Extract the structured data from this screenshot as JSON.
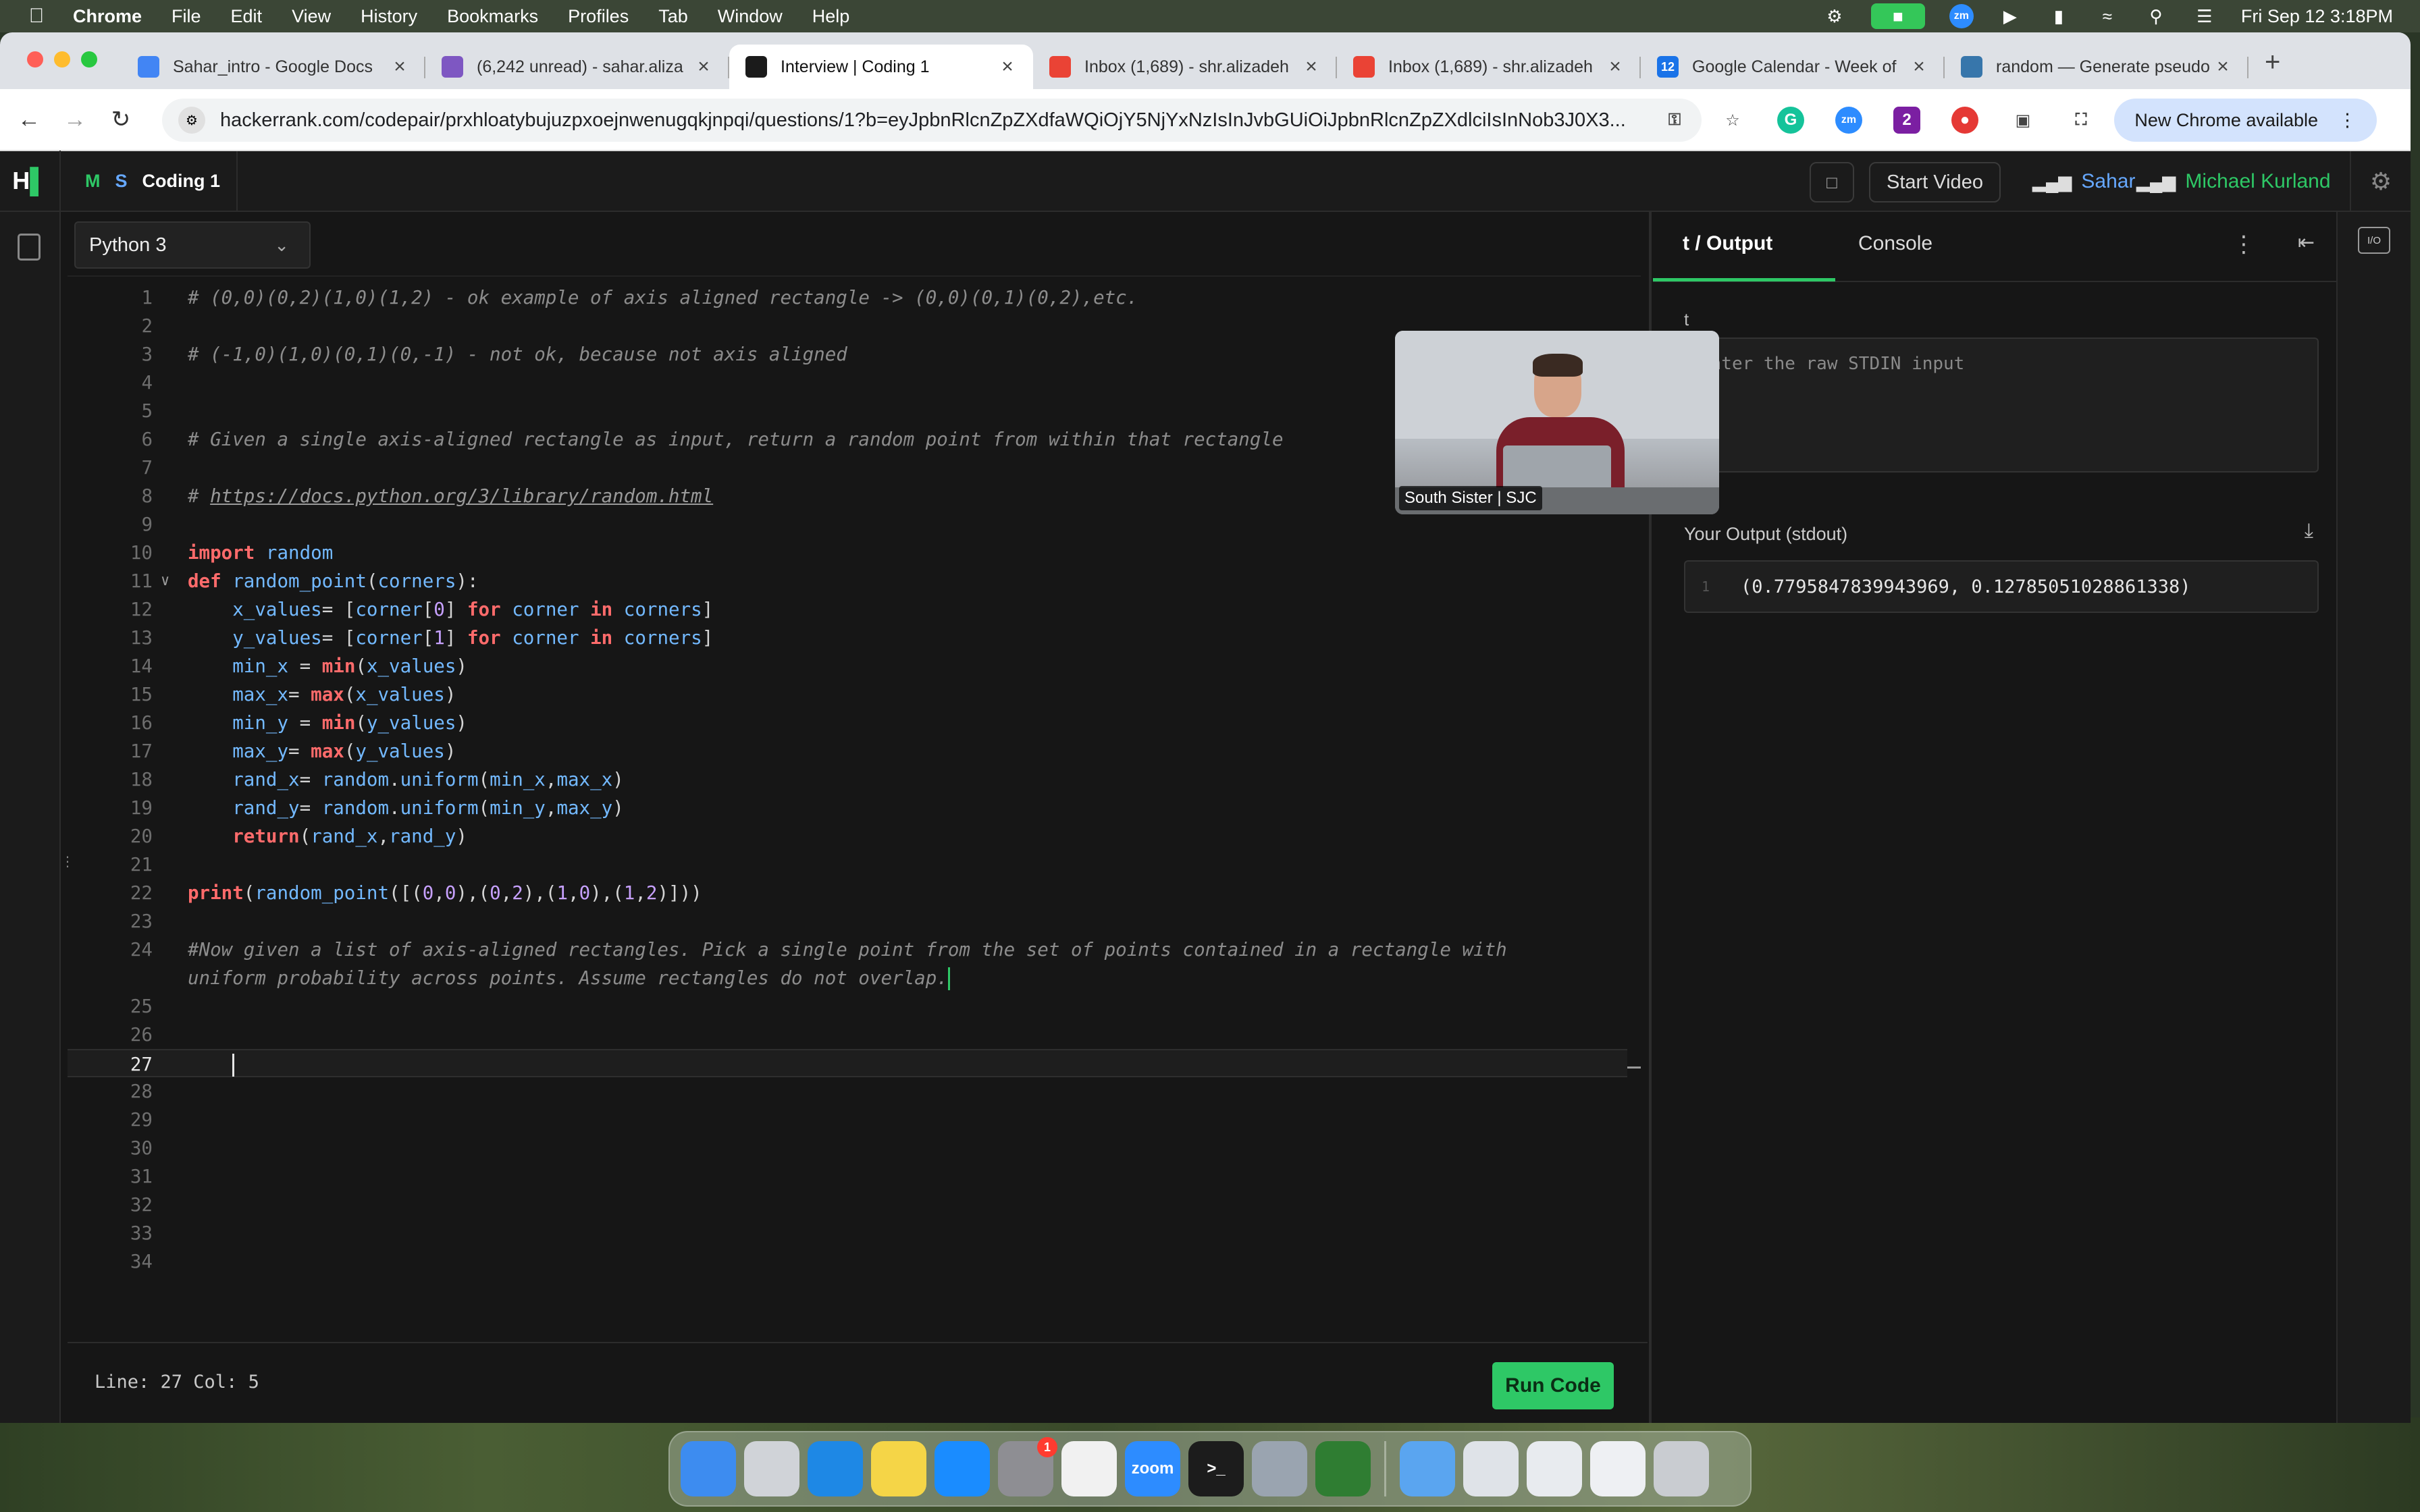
{
  "menubar": {
    "app": "Chrome",
    "items": [
      "File",
      "Edit",
      "View",
      "History",
      "Bookmarks",
      "Profiles",
      "Tab",
      "Window",
      "Help"
    ],
    "clock": "Fri Sep 12  3:18PM",
    "zoom_icon": "zm"
  },
  "tabs": [
    {
      "title": "Sahar_intro - Google Docs",
      "icon": "docs-icon",
      "color": "#4285f4"
    },
    {
      "title": "(6,242 unread) - sahar.aliza",
      "icon": "mail-icon",
      "color": "#7e57c2"
    },
    {
      "title": "Interview | Coding 1",
      "icon": "hackerrank-icon",
      "color": "#1b1b1b",
      "active": true
    },
    {
      "title": "Inbox (1,689) - shr.alizadeh",
      "icon": "gmail-icon",
      "color": "#ea4335"
    },
    {
      "title": "Inbox (1,689) - shr.alizadeh",
      "icon": "gmail-icon",
      "color": "#ea4335"
    },
    {
      "title": "Google Calendar - Week of",
      "icon": "calendar-icon",
      "color": "#1a73e8",
      "badge": "12"
    },
    {
      "title": "random — Generate pseudo",
      "icon": "python-icon",
      "color": "#3776ab"
    }
  ],
  "toolbar": {
    "url": "hackerrank.com/codepair/prxhloatybujuzpxoejnwenugqkjnpqi/questions/1?b=eyJpbnRlcnZpZXdfaWQiOjY5NjYxNzIsInJvbGUiOiJpbnRlcnZpZXdlciIsInNob3J0X3...",
    "new_chrome": "New Chrome available"
  },
  "header": {
    "logo": "H",
    "initials_m": "M",
    "initials_s": "S",
    "title": "Coding 1",
    "start_video": "Start Video",
    "participants": [
      {
        "name": "Sahar",
        "color": "#66a8ff"
      },
      {
        "name": "Michael Kurland",
        "color": "#2ec866"
      }
    ]
  },
  "editor": {
    "language": "Python 3",
    "status": "Line: 27 Col: 5",
    "run_label": "Run Code",
    "lines": [
      {
        "n": "1",
        "html": "<span class='cm'># (0,0)(0,2)(1,0)(1,2) - ok example of axis aligned rectangle -&gt; (0,0)(0,1)(0,2),etc.</span>"
      },
      {
        "n": "2",
        "html": ""
      },
      {
        "n": "3",
        "html": "<span class='cm'># (-1,0)(1,0)(0,1)(0,-1) - not ok, because not axis aligned</span>"
      },
      {
        "n": "4",
        "html": ""
      },
      {
        "n": "5",
        "html": ""
      },
      {
        "n": "6",
        "html": "<span class='cm'># Given a single axis-aligned rectangle as input, return a random point from within that rectangle</span>"
      },
      {
        "n": "7",
        "html": ""
      },
      {
        "n": "8",
        "html": "<span class='cm'># </span><span class='link'>https://docs.python.org/3/library/random.html</span>"
      },
      {
        "n": "9",
        "html": ""
      },
      {
        "n": "10",
        "html": "<span class='kw'>import</span> <span class='fn'>random</span>"
      },
      {
        "n": "11",
        "html": "<span class='kw'>def</span> <span class='fn'>random_point</span>(<span class='fn'>corners</span>):"
      },
      {
        "n": "12",
        "html": "    <span class='fn'>x_values</span>= [<span class='fn'>corner</span>[<span class='num'>0</span>] <span class='kw'>for</span> <span class='fn'>corner</span> <span class='kw'>in</span> <span class='fn'>corners</span>]"
      },
      {
        "n": "13",
        "html": "    <span class='fn'>y_values</span>= [<span class='fn'>corner</span>[<span class='num'>1</span>] <span class='kw'>for</span> <span class='fn'>corner</span> <span class='kw'>in</span> <span class='fn'>corners</span>]"
      },
      {
        "n": "14",
        "html": "    <span class='fn'>min_x</span> = <span class='kw'>min</span>(<span class='fn'>x_values</span>)"
      },
      {
        "n": "15",
        "html": "    <span class='fn'>max_x</span>= <span class='kw'>max</span>(<span class='fn'>x_values</span>)"
      },
      {
        "n": "16",
        "html": "    <span class='fn'>min_y</span> = <span class='kw'>min</span>(<span class='fn'>y_values</span>)"
      },
      {
        "n": "17",
        "html": "    <span class='fn'>max_y</span>= <span class='kw'>max</span>(<span class='fn'>y_values</span>)"
      },
      {
        "n": "18",
        "html": "    <span class='fn'>rand_x</span>= <span class='fn'>random</span>.<span class='fn'>uniform</span>(<span class='fn'>min_x</span>,<span class='fn'>max_x</span>)"
      },
      {
        "n": "19",
        "html": "    <span class='fn'>rand_y</span>= <span class='fn'>random</span>.<span class='fn'>uniform</span>(<span class='fn'>min_y</span>,<span class='fn'>max_y</span>)"
      },
      {
        "n": "20",
        "html": "    <span class='kw'>return</span>(<span class='fn'>rand_x</span>,<span class='fn'>rand_y</span>)"
      },
      {
        "n": "21",
        "html": ""
      },
      {
        "n": "22",
        "html": "<span class='kw'>print</span>(<span class='fn'>random_point</span>([(<span class='num'>0</span>,<span class='num'>0</span>),(<span class='num'>0</span>,<span class='num'>2</span>),(<span class='num'>1</span>,<span class='num'>0</span>),(<span class='num'>1</span>,<span class='num'>2</span>)]))"
      },
      {
        "n": "23",
        "html": ""
      },
      {
        "n": "24",
        "html": "<span class='cm'>#Now given a list of axis-aligned rectangles. Pick a single point from the set of points contained in a rectangle with</span>"
      },
      {
        "n": "",
        "html": "<span class='cm'>uniform probability across points. Assume rectangles do not overlap.</span><span class='cursor green'></span>"
      },
      {
        "n": "25",
        "html": ""
      },
      {
        "n": "26",
        "html": ""
      },
      {
        "n": "27",
        "html": "    <span class='cursor'></span>",
        "active": true
      },
      {
        "n": "28",
        "html": ""
      },
      {
        "n": "29",
        "html": ""
      },
      {
        "n": "30",
        "html": ""
      },
      {
        "n": "31",
        "html": ""
      },
      {
        "n": "32",
        "html": ""
      },
      {
        "n": "33",
        "html": ""
      },
      {
        "n": "34",
        "html": ""
      }
    ]
  },
  "io": {
    "tab_io": "t / Output",
    "tab_console": "Console",
    "input_label": "t",
    "stdin_placeholder": "Enter the raw STDIN input",
    "output_label": "Your Output (stdout)",
    "output_line_no": "1",
    "output_value": "(0.7795847839943969, 0.12785051028861338)"
  },
  "video": {
    "caption": "South Sister | SJC"
  },
  "dock": [
    {
      "name": "finder",
      "color": "#3d8cf0"
    },
    {
      "name": "launchpad",
      "color": "#d0d3d8"
    },
    {
      "name": "safari",
      "color": "#1e88e5"
    },
    {
      "name": "notes",
      "color": "#f5d547"
    },
    {
      "name": "app-store",
      "color": "#1a8cff"
    },
    {
      "name": "system-settings",
      "color": "#8e8e93",
      "badge": "1"
    },
    {
      "name": "chrome",
      "color": "#f1f1f1"
    },
    {
      "name": "zoom",
      "color": "#2d8cff",
      "label": "zoom"
    },
    {
      "name": "terminal",
      "color": "#1c1c1c",
      "label": ">_"
    },
    {
      "name": "preview",
      "color": "#9aa4b0"
    },
    {
      "name": "activity",
      "color": "#2f7d32"
    },
    {
      "name": "sep"
    },
    {
      "name": "downloads-folder",
      "color": "#5aa5f0"
    },
    {
      "name": "screenshot-1",
      "color": "#dfe3e8"
    },
    {
      "name": "screenshot-2",
      "color": "#e8ebef"
    },
    {
      "name": "screenshot-3",
      "color": "#eef0f3"
    },
    {
      "name": "trash",
      "color": "#c9ccd1"
    }
  ]
}
